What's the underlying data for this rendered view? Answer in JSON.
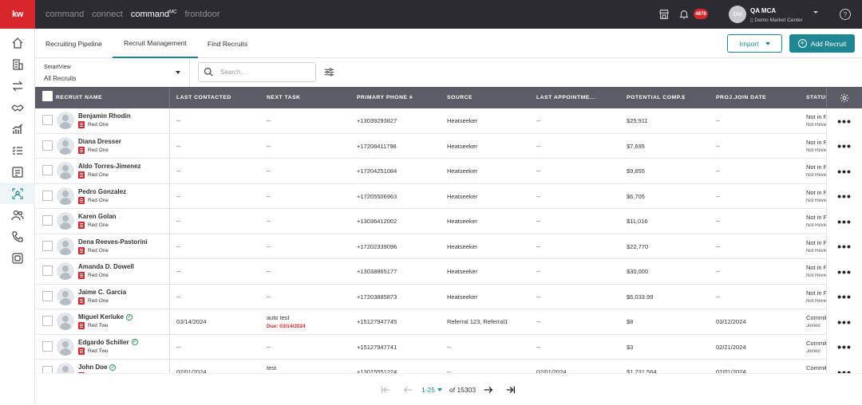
{
  "brand": {
    "logo": "kw",
    "accent": "#1e8793",
    "logo_bg": "#d7262c"
  },
  "top_nav": {
    "apps": [
      "command",
      "connect",
      "command",
      "frontdoor"
    ],
    "active_superscript": "MC",
    "notification_count": "4878",
    "user": {
      "initials": "DM",
      "name": "QA MCA",
      "market_center": "Demo Market Center"
    },
    "help": "?"
  },
  "sidebar": {
    "items": [
      "home-icon",
      "buildings-icon",
      "transactions-icon",
      "handshake-icon",
      "reports-icon",
      "tasks-icon",
      "forms-icon",
      "recruit-icon",
      "people-icon",
      "phone-icon",
      "gallery-icon"
    ],
    "active_index": 7
  },
  "tabs": [
    "Recruiting Pipeline",
    "Recruit Management",
    "Find Recruits"
  ],
  "active_tab": 1,
  "actions": {
    "import": "Import",
    "add": "Add Recruit"
  },
  "smartview": {
    "label": "SmartView",
    "value": "All Recruits"
  },
  "search": {
    "placeholder": "Search..."
  },
  "table": {
    "headers": [
      "RECRUIT NAME",
      "LAST CONTACTED",
      "NEXT TASK",
      "PRIMARY PHONE #",
      "SOURCE",
      "LAST APPOINTME...",
      "POTENTIAL COMP.$",
      "PROJ.JOIN DATE",
      "STATUS"
    ],
    "rows": [
      {
        "name": "Benjamin Rhodin",
        "verified": false,
        "type": "Red One",
        "last_contacted": "--",
        "task": "--",
        "task_due": "",
        "phone": "+13039293827",
        "source": "Heatseeker",
        "last_appt": "--",
        "comp": "$25,911",
        "join": "--",
        "status": "Not in Pipeline",
        "status_sub": "Not Reviewed"
      },
      {
        "name": "Diana Dresser",
        "verified": false,
        "type": "Red One",
        "last_contacted": "--",
        "task": "--",
        "task_due": "",
        "phone": "+17208411798",
        "source": "Heatseeker",
        "last_appt": "--",
        "comp": "$7,695",
        "join": "--",
        "status": "Not in Pipeline",
        "status_sub": "Not Reviewed"
      },
      {
        "name": "Aldo Torres-Jimenez",
        "verified": false,
        "type": "Red One",
        "last_contacted": "--",
        "task": "--",
        "task_due": "",
        "phone": "+17204251084",
        "source": "Heatseeker",
        "last_appt": "--",
        "comp": "$9,855",
        "join": "--",
        "status": "Not in Pipeline",
        "status_sub": "Not Reviewed"
      },
      {
        "name": "Pedro Gonzalez",
        "verified": false,
        "type": "Red One",
        "last_contacted": "--",
        "task": "--",
        "task_due": "",
        "phone": "+17205506963",
        "source": "Heatseeker",
        "last_appt": "--",
        "comp": "$6,705",
        "join": "--",
        "status": "Not in Pipeline",
        "status_sub": "Not Reviewed"
      },
      {
        "name": "Karen Golan",
        "verified": false,
        "type": "Red One",
        "last_contacted": "--",
        "task": "--",
        "task_due": "",
        "phone": "+13036412002",
        "source": "Heatseeker",
        "last_appt": "--",
        "comp": "$11,016",
        "join": "--",
        "status": "Not in Pipeline",
        "status_sub": "Not Reviewed"
      },
      {
        "name": "Dena Reeves-Pastorini",
        "verified": false,
        "type": "Red One",
        "last_contacted": "--",
        "task": "--",
        "task_due": "",
        "phone": "+17202339096",
        "source": "Heatseeker",
        "last_appt": "--",
        "comp": "$22,770",
        "join": "--",
        "status": "Not in Pipeline",
        "status_sub": "Not Reviewed"
      },
      {
        "name": "Amanda D. Dowell",
        "verified": false,
        "type": "Red One",
        "last_contacted": "--",
        "task": "--",
        "task_due": "",
        "phone": "+13038865177",
        "source": "Heatseeker",
        "last_appt": "--",
        "comp": "$30,000",
        "join": "--",
        "status": "Not in Pipeline",
        "status_sub": "Not Reviewed"
      },
      {
        "name": "Jaime C. Garcia",
        "verified": false,
        "type": "Red One",
        "last_contacted": "--",
        "task": "--",
        "task_due": "",
        "phone": "+17203885873",
        "source": "Heatseeker",
        "last_appt": "--",
        "comp": "$6,033.99",
        "join": "--",
        "status": "Not in Pipeline",
        "status_sub": "Not Reviewed"
      },
      {
        "name": "Miguel Kerluke",
        "verified": true,
        "type": "Red Two",
        "last_contacted": "03/14/2024",
        "task": "auto test",
        "task_due": "Due: 03/14/2024",
        "phone": "+15127947745",
        "source": "Referral 123, Referral1",
        "last_appt": "--",
        "comp": "$8",
        "join": "03/12/2024",
        "status": "Committed",
        "status_sub": "Joined"
      },
      {
        "name": "Edgardo Schiller",
        "verified": true,
        "type": "Red Two",
        "last_contacted": "--",
        "task": "--",
        "task_due": "",
        "phone": "+15127947741",
        "source": "--",
        "last_appt": "--",
        "comp": "$3",
        "join": "02/21/2024",
        "status": "Committed",
        "status_sub": "Joined"
      },
      {
        "name": "John Doe",
        "verified": true,
        "type": "Red Two",
        "last_contacted": "02/01/2024",
        "task": "test",
        "task_due": "",
        "phone": "+13015551224",
        "source": "--",
        "last_appt": "02/01/2024",
        "comp": "$1,231,564",
        "join": "02/01/2024",
        "status": "Committed",
        "status_sub": "Joined"
      }
    ]
  },
  "pagination": {
    "range": "1-25",
    "of": "of 15303"
  }
}
